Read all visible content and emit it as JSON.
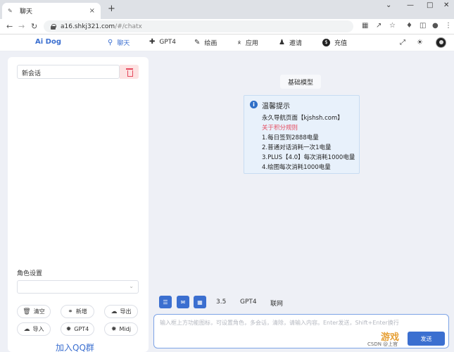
{
  "browser": {
    "tab_title": "聊天",
    "url_main": "a16.shkj321.com",
    "url_path": "/#/chatx",
    "new_tab": "+",
    "tab_close": "×"
  },
  "header": {
    "brand": "Ai Dog",
    "nav": [
      {
        "label": "聊天",
        "icon": "location-pin-icon"
      },
      {
        "label": "GPT4",
        "icon": "plus-icon"
      },
      {
        "label": "绘画",
        "icon": "pencil-icon"
      },
      {
        "label": "应用",
        "icon": "app-icon"
      },
      {
        "label": "邀请",
        "icon": "invite-user-icon"
      },
      {
        "label": "充值",
        "icon": "dollar-icon"
      }
    ],
    "accent": "#3b6fd0"
  },
  "sidebar": {
    "conversation": "新会话",
    "role_label": "角色设置",
    "buttons": [
      {
        "label": "清空",
        "icon": "trash-icon"
      },
      {
        "label": "新增",
        "icon": "headset-icon"
      },
      {
        "label": "导出",
        "icon": "cloud-upload-icon"
      },
      {
        "label": "导入",
        "icon": "cloud-download-icon"
      },
      {
        "label": "GPT4",
        "icon": "settings-icon"
      },
      {
        "label": "Midj",
        "icon": "settings-icon"
      }
    ],
    "qq_link": "加入QQ群"
  },
  "main": {
    "model_button": "基础模型",
    "tip": {
      "title": "温馨提示",
      "lines": [
        "永久导航页面【kjshsh.com】",
        "关于积分规则",
        "1.每日签到2888电量",
        "2.普通对话消耗一次1电量",
        "3.PLUS【4.0】每次消耗1000电量",
        "4.绘图每次消耗1000电量"
      ]
    },
    "toolbar_options": [
      "3.5",
      "GPT4",
      "联网"
    ],
    "input_placeholder": "输入框上方功能图标，可设置角色，多会话，清除，请输入内容。Enter发送，Shift+Enter换行",
    "send_label": "发送"
  },
  "watermark": {
    "logo": "游戏",
    "csdn": "CSDN @上官"
  }
}
